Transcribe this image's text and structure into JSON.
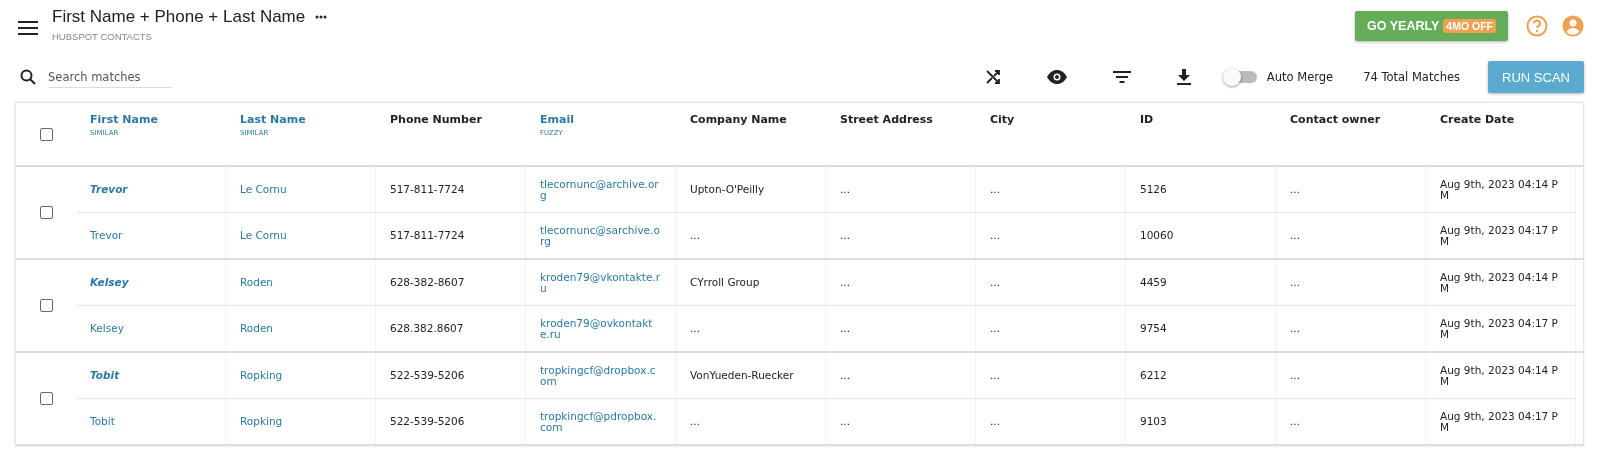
{
  "header": {
    "title": "First Name + Phone + Last Name",
    "subtitle": "HUBSPOT CONTACTS",
    "upgrade_button": {
      "label": "GO YEARLY",
      "badge": "4MO OFF"
    }
  },
  "toolbar": {
    "search": {
      "placeholder": "Search matches"
    },
    "auto_merge": {
      "label": "Auto Merge",
      "on": false
    },
    "total_matches": "74 Total Matches",
    "run_button": "RUN SCAN"
  },
  "table": {
    "select_all": {
      "checked": false
    },
    "columns": [
      {
        "label": "First Name",
        "tag": "SIMILAR"
      },
      {
        "label": "Last Name",
        "tag": "SIMILAR"
      },
      {
        "label": "Phone Number"
      },
      {
        "label": "Email",
        "tag": "FUZZY"
      },
      {
        "label": "Company Name"
      },
      {
        "label": "Street Address"
      },
      {
        "label": "City"
      },
      {
        "label": "ID"
      },
      {
        "label": "Contact owner"
      },
      {
        "label": "Create Date"
      }
    ],
    "groups": [
      {
        "checked": false,
        "records": [
          {
            "primary": true,
            "cells": [
              "Trevor",
              "Le Cornu",
              "517-811-7724",
              "tlecornunc@archive.org",
              "Upton-O'Peilly",
              "...",
              "...",
              "5126",
              "...",
              "Aug 9th, 2023 04:14 PM"
            ]
          },
          {
            "primary": false,
            "cells": [
              "Trevor",
              "Le Cornu",
              "517-811-7724",
              "tlecornunc@sarchive.org",
              "...",
              "...",
              "...",
              "10060",
              "...",
              "Aug 9th, 2023 04:17 PM"
            ]
          }
        ]
      },
      {
        "checked": false,
        "records": [
          {
            "primary": true,
            "cells": [
              "Kelsey",
              "Roden",
              "628-382-8607",
              "kroden79@vkontakte.ru",
              "CYrroll Group",
              "...",
              "...",
              "4459",
              "...",
              "Aug 9th, 2023 04:14 PM"
            ]
          },
          {
            "primary": false,
            "cells": [
              "Kelsey",
              "Roden",
              "628.382.8607",
              "kroden79@ovkontakte.ru",
              "...",
              "...",
              "...",
              "9754",
              "...",
              "Aug 9th, 2023 04:17 PM"
            ]
          }
        ]
      },
      {
        "checked": false,
        "records": [
          {
            "primary": true,
            "cells": [
              "Tobit",
              "Ropking",
              "522-539-5206",
              "tropkingcf@dropbox.com",
              "VonYueden-Ruecker",
              "...",
              "...",
              "6212",
              "...",
              "Aug 9th, 2023 04:14 PM"
            ]
          },
          {
            "primary": false,
            "cells": [
              "Tobit",
              "Ropking",
              "522-539-5206",
              "tropkingcf@pdropbox.com",
              "...",
              "...",
              "...",
              "9103",
              "...",
              "Aug 9th, 2023 04:17 PM"
            ]
          }
        ]
      }
    ]
  }
}
